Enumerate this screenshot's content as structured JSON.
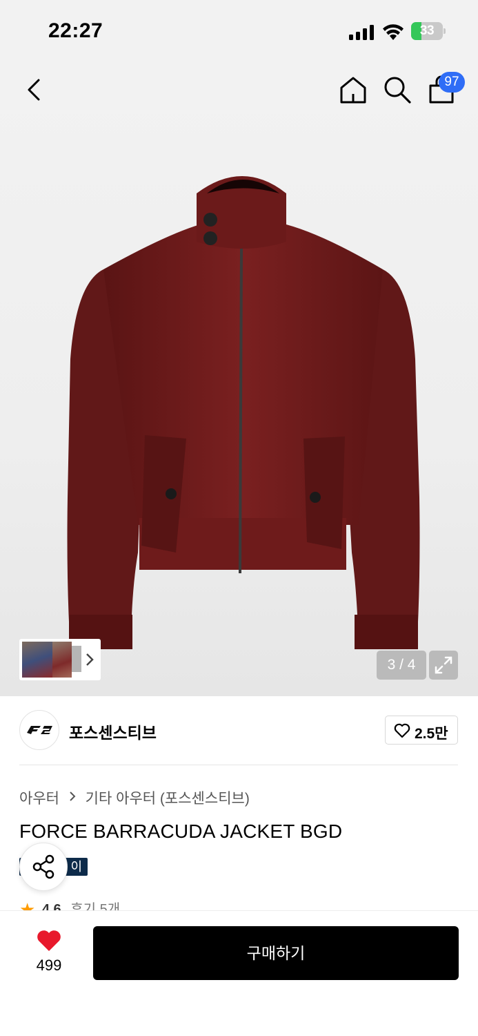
{
  "status_bar": {
    "time": "22:27",
    "battery_percent": "33",
    "battery_level": 0.33,
    "icons": [
      "signal-icon",
      "wifi-icon",
      "battery-icon"
    ]
  },
  "nav": {
    "icons": [
      "back-icon",
      "home-icon",
      "search-icon",
      "cart-icon"
    ],
    "cart_count": "97"
  },
  "gallery": {
    "page_counter": "3 / 4",
    "expand_icon": "expand-icon",
    "thumbnail_count": 3
  },
  "brand": {
    "name": "포스센스티브",
    "like_count": "2.5만"
  },
  "product": {
    "breadcrumb": [
      "아우터",
      "기타 아우터 (포스센스티브)"
    ],
    "title": "FORCE BARRACUDA JACKET BGD",
    "pay_badge": "이",
    "rating": "4.6",
    "review_label": "후기 5개"
  },
  "bottom_bar": {
    "wish_count": "499",
    "buy_label": "구매하기"
  },
  "colors": {
    "accent_blue": "#2f6df6",
    "jacket": "#6a1a1a",
    "heart_red": "#e8192c",
    "battery_green": "#34c759",
    "badge_navy": "#0d2b4a"
  }
}
